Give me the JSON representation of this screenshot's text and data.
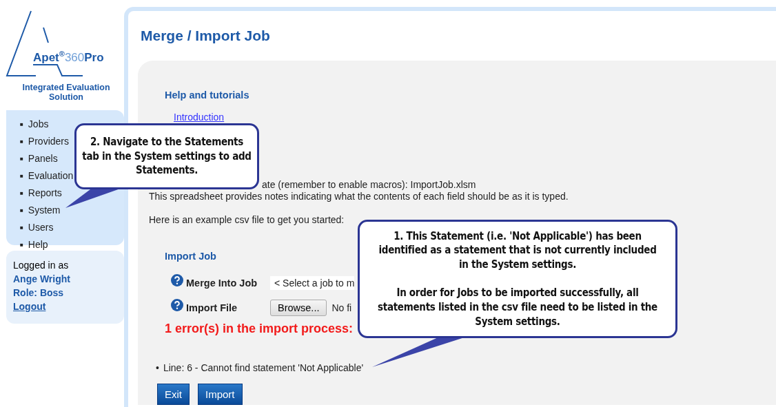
{
  "logo": {
    "brand": "Apet",
    "mark": "®",
    "number": "360",
    "suffix": "Pro",
    "tagline": "Integrated Evaluation Solution"
  },
  "nav": [
    {
      "marker": "■",
      "label": "Jobs"
    },
    {
      "marker": "■",
      "label": "Providers"
    },
    {
      "marker": "■",
      "label": "Panels"
    },
    {
      "marker": "■",
      "label": "Evaluation"
    },
    {
      "marker": "■",
      "label": "Reports"
    },
    {
      "marker": "■",
      "label": "System"
    },
    {
      "marker": "■",
      "label": "Users"
    },
    {
      "marker": "■",
      "label": "Help"
    }
  ],
  "session": {
    "prefix": "Logged in as",
    "user": "Ange Wright",
    "role": "Role: Boss",
    "logout": "Logout"
  },
  "page_title": "Merge / Import Job",
  "help": {
    "heading": "Help and tutorials",
    "link": "Introduction",
    "template_line": "ate (remember to enable macros): ImportJob.xlsm",
    "notes_line": "This spreadsheet provides notes indicating what the contents of each field should be as it is typed.",
    "example_line": "Here is an example csv file to get you started:"
  },
  "form": {
    "heading": "Import Job",
    "fields": [
      {
        "kind": "select",
        "label": "Merge Into Job",
        "value": "< Select a job to m"
      },
      {
        "kind": "file",
        "label": "Import File",
        "button": "Browse...",
        "value": "No fi"
      }
    ]
  },
  "errors": {
    "heading": "1 error(s) in the import process:",
    "items": [
      {
        "marker": "•",
        "text": "Line: 6 - Cannot find statement 'Not Applicable'"
      }
    ]
  },
  "buttons": [
    "Exit",
    "Import"
  ],
  "callouts": [
    {
      "text": "2. Navigate to the Statements tab in the System settings to add Statements."
    },
    {
      "text": "1. This Statement (i.e. 'Not Applicable') has been identified as a statement that is not currently included in the System settings.\n\nIn order for Jobs to be imported successfully, all statements listed in the csv file need to be listed in the System settings."
    }
  ]
}
